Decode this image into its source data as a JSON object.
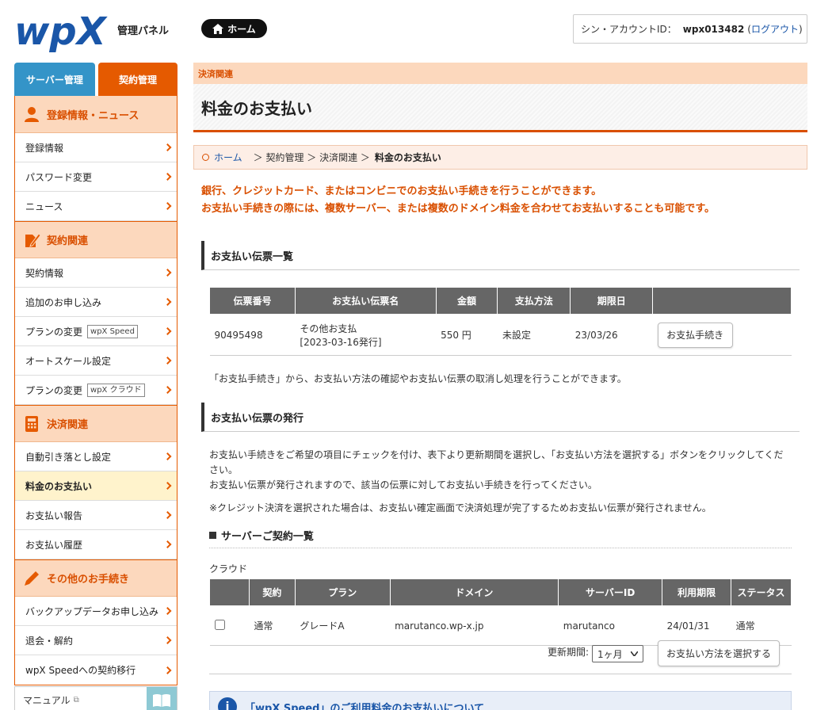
{
  "header": {
    "logo": "wpX",
    "panel_title": "管理パネル",
    "home_label": "ホーム",
    "account_label": "シン・アカウントID：",
    "account_id": "wpx013482",
    "logout_label": "ログアウト"
  },
  "tabs": {
    "server": "サーバー管理",
    "contract": "契約管理"
  },
  "sidebar": {
    "sections": [
      {
        "title": "登録情報・ニュース",
        "icon": "person-icon",
        "items": [
          {
            "label": "登録情報"
          },
          {
            "label": "パスワード変更"
          },
          {
            "label": "ニュース"
          }
        ]
      },
      {
        "title": "契約関連",
        "icon": "document-pen-icon",
        "items": [
          {
            "label": "契約情報"
          },
          {
            "label": "追加のお申し込み"
          },
          {
            "label": "プランの変更",
            "tag": "wpX Speed"
          },
          {
            "label": "オートスケール設定"
          },
          {
            "label": "プランの変更",
            "tag": "wpX クラウド"
          }
        ]
      },
      {
        "title": "決済関連",
        "icon": "calculator-icon",
        "items": [
          {
            "label": "自動引き落とし設定"
          },
          {
            "label": "料金のお支払い",
            "active": true
          },
          {
            "label": "お支払い報告"
          },
          {
            "label": "お支払い履歴"
          }
        ]
      },
      {
        "title": "その他のお手続き",
        "icon": "pencil-icon",
        "items": [
          {
            "label": "バックアップデータお申し込み"
          },
          {
            "label": "退会・解約"
          },
          {
            "label": "wpX Speedへの契約移行"
          }
        ]
      }
    ],
    "manual_label": "マニュアル"
  },
  "page": {
    "category": "決済関連",
    "title": "料金のお支払い",
    "breadcrumb": {
      "home": "ホーム",
      "path": "＞ 契約管理 ＞ 決済関連 ＞",
      "current": "料金のお支払い"
    },
    "lead_lines": [
      "銀行、クレジットカード、またはコンビニでのお支払い手続きを行うことができます。",
      "お支払い手続きの際には、複数サーバー、または複数のドメイン料金を合わせてお支払いすることも可能です。"
    ]
  },
  "invoices": {
    "heading": "お支払い伝票一覧",
    "columns": [
      "伝票番号",
      "お支払い伝票名",
      "金額",
      "支払方法",
      "期限日",
      ""
    ],
    "rows": [
      {
        "number": "90495498",
        "name1": "その他お支払",
        "name2": "[2023-03-16発行]",
        "amount": "550 円",
        "method": "未設定",
        "due": "23/03/26",
        "action": "お支払手続き"
      }
    ],
    "note": "「お支払手続き」から、お支払い方法の確認やお支払い伝票の取消し処理を行うことができます。"
  },
  "issue": {
    "heading": "お支払い伝票の発行",
    "notes": [
      "お支払い手続きをご希望の項目にチェックを付け、表下より更新期間を選択し、「お支払い方法を選択する」ボタンをクリックしてくだ",
      "さい。",
      "お支払い伝票が発行されますので、該当の伝票に対してお支払い手続きを行ってください。"
    ],
    "credit_note": "※クレジット決済を選択された場合は、お支払い確定画面で決済処理が完了するためお支払い伝票が発行されません。",
    "server_heading": "サーバーご契約一覧",
    "group": "クラウド",
    "columns": [
      "",
      "契約",
      "プラン",
      "ドメイン",
      "サーバーID",
      "利用期限",
      "ステータス"
    ],
    "rows": [
      {
        "contract": "通常",
        "plan": "グレードA",
        "domain": "marutanco.wp-x.jp",
        "server_id": "marutanco",
        "expiry": "24/01/31",
        "status": "通常"
      }
    ],
    "period_label": "更新期間:",
    "period_value": "1ヶ月",
    "select_button": "お支払い方法を選択する"
  },
  "info": {
    "link": "「wpX Speed」のご利用料金のお支払いについて"
  },
  "colors": {
    "accent": "#e55a00",
    "blue": "#3494c8",
    "logo": "#1a56a8"
  }
}
